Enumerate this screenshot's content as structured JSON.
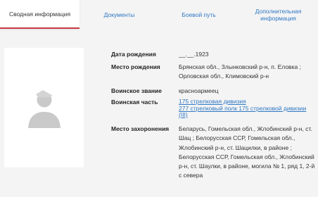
{
  "tabs": [
    {
      "label": "Сводная информация"
    },
    {
      "label": "Документы"
    },
    {
      "label": "Боевой путь"
    },
    {
      "label": "Дополнительная информация"
    }
  ],
  "icons": {
    "avatar": "person-silhouette-icon"
  },
  "colors": {
    "link": "#2f78c4",
    "active_tab_underline": "#c8383f",
    "background": "#f4f4f4"
  },
  "info": {
    "birthdate": {
      "label": "Дата рождения",
      "value": "__.__.1923"
    },
    "birthplace": {
      "label": "Место рождения",
      "value": "Брянская обл., Злынковский р-н, п. Еловка ; Орловская обл., Климовский р-н"
    },
    "rank": {
      "label": "Воинское звание",
      "value": "красноармеец"
    },
    "unit": {
      "label": "Воинская часть",
      "links": [
        "175 стрелковая дивизия",
        "277 стрелковый полк 175 стрелковой дивизии (III)"
      ]
    },
    "burial": {
      "label": "Место захоронения",
      "value": "Беларусь, Гомельская обл., Жлобинский р-н, ст. Шац ; Белорусская ССР, Гомельская обл., Жлобинский р-н, ст. Шацилки, в районе ; Белорусская ССР, Гомельская обл., Жлобинский р-н, ст. Шаулки, в районе, могила № 1, ряд 1, 2-й с севера"
    }
  }
}
